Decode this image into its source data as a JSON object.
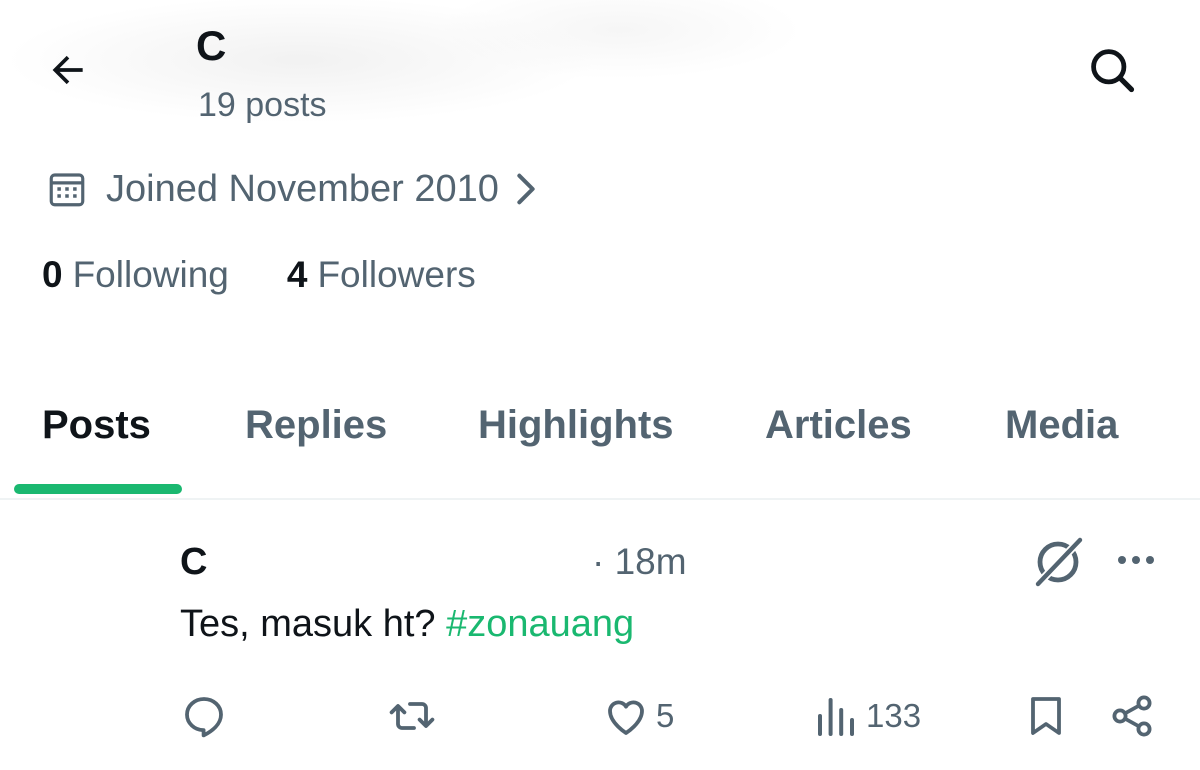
{
  "header": {
    "back_icon": "arrow-left-icon",
    "profile_name": "C",
    "post_count": "19 posts",
    "search_icon": "search-icon"
  },
  "profile": {
    "joined_icon": "calendar-icon",
    "joined_text": "Joined November 2010",
    "joined_chevron_icon": "chevron-right-icon",
    "following_count": "0",
    "following_label": "Following",
    "followers_count": "4",
    "followers_label": "Followers"
  },
  "tabs": [
    {
      "label": "Posts",
      "active": true
    },
    {
      "label": "Replies",
      "active": false
    },
    {
      "label": "Highlights",
      "active": false
    },
    {
      "label": "Articles",
      "active": false
    },
    {
      "label": "Media",
      "active": false
    }
  ],
  "post": {
    "author": "C",
    "time": "· 18m",
    "text": "Tes, masuk ht? ",
    "hashtag": "#zonauang",
    "actions": {
      "reply_icon": "reply-icon",
      "repost_icon": "repost-icon",
      "like_icon": "heart-icon",
      "like_count": "5",
      "views_icon": "views-icon",
      "views_count": "133",
      "bookmark_icon": "bookmark-icon",
      "share_icon": "share-icon"
    },
    "grok_icon": "grok-icon",
    "more_icon": "more-icon"
  },
  "colors": {
    "accent": "#1ab870",
    "text_primary": "#0f1419",
    "text_secondary": "#536471",
    "divider": "#eff3f4"
  }
}
